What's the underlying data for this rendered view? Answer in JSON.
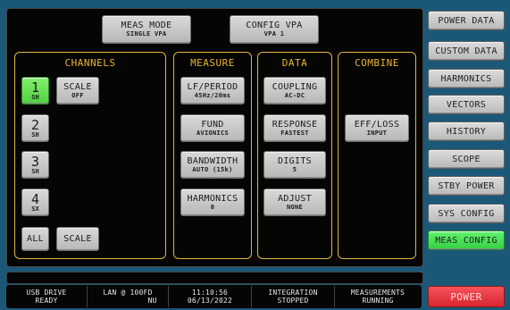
{
  "top_buttons": {
    "meas_mode": {
      "label": "MEAS MODE",
      "sub": "SINGLE VPA"
    },
    "config_vpa": {
      "label": "CONFIG VPA",
      "sub": "VPA 1"
    }
  },
  "channels": {
    "title": "CHANNELS",
    "items": [
      {
        "num": "1",
        "sub": "SH",
        "active": true
      },
      {
        "num": "2",
        "sub": "SH",
        "active": false
      },
      {
        "num": "3",
        "sub": "SH",
        "active": false
      },
      {
        "num": "4",
        "sub": "SX",
        "active": false
      }
    ],
    "scale": {
      "label": "SCALE",
      "sub": "OFF"
    },
    "all_label": "ALL",
    "scale_bottom_label": "SCALE"
  },
  "measure": {
    "title": "MEASURE",
    "buttons": [
      {
        "label": "LF/PERIOD",
        "sub": "45Hz/20ms"
      },
      {
        "label": "FUND",
        "sub": "AVIONICS"
      },
      {
        "label": "BANDWIDTH",
        "sub": "AUTO (15k)"
      },
      {
        "label": "HARMONICS",
        "sub": "0"
      }
    ]
  },
  "data": {
    "title": "DATA",
    "buttons": [
      {
        "label": "COUPLING",
        "sub": "AC-DC"
      },
      {
        "label": "RESPONSE",
        "sub": "FASTEST"
      },
      {
        "label": "DIGITS",
        "sub": "5"
      },
      {
        "label": "ADJUST",
        "sub": "NONE"
      }
    ]
  },
  "combine": {
    "title": "COMBINE",
    "button": {
      "label": "EFF/LOSS",
      "sub": "INPUT"
    }
  },
  "sidebar": {
    "items": [
      {
        "label": "POWER DATA",
        "active": false
      },
      {
        "label": "CUSTOM DATA",
        "active": false
      },
      {
        "label": "HARMONICS",
        "active": false
      },
      {
        "label": "VECTORS",
        "active": false
      },
      {
        "label": "HISTORY",
        "active": false
      },
      {
        "label": "SCOPE",
        "active": false
      },
      {
        "label": "STBY POWER",
        "active": false
      },
      {
        "label": "SYS CONFIG",
        "active": false
      },
      {
        "label": "MEAS CONFIG",
        "active": true
      }
    ],
    "power_label": "POWER"
  },
  "status": {
    "cells": [
      {
        "l1": "USB DRIVE",
        "l2": "READY"
      },
      {
        "l1": "LAN @ 100FD",
        "l2": "           NU"
      },
      {
        "l1": "11:10:56",
        "l2": "06/13/2022"
      },
      {
        "l1": "INTEGRATION",
        "l2": "STOPPED"
      },
      {
        "l1": "MEASUREMENTS",
        "l2": "RUNNING"
      }
    ]
  },
  "colors": {
    "background": "#1b5878",
    "panel_border": "#e0b53c",
    "title": "#eab532",
    "active": "#4fd23f",
    "power": "#d8262f"
  }
}
